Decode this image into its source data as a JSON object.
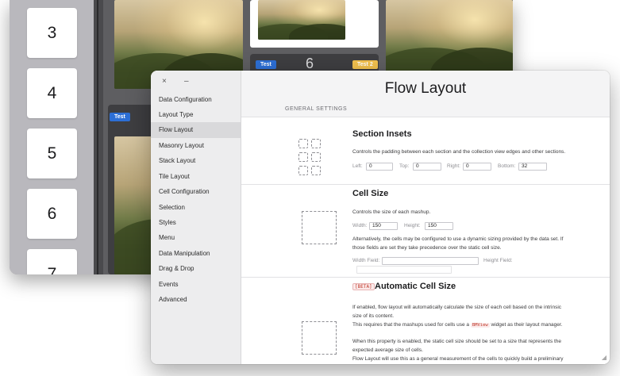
{
  "back_window": {
    "sidebar_tiles": [
      "3",
      "4",
      "5",
      "6",
      "7"
    ],
    "badges": {
      "test_left": "Test",
      "test_mid": "Test",
      "test_right": "Test 2",
      "counter": "6"
    }
  },
  "front_window": {
    "controls": {
      "close": "×",
      "minimize": "–"
    },
    "sidebar": {
      "items": [
        {
          "label": "Data Configuration"
        },
        {
          "label": "Layout Type"
        },
        {
          "label": "Flow Layout"
        },
        {
          "label": "Masonry Layout"
        },
        {
          "label": "Stack Layout"
        },
        {
          "label": "Tile Layout"
        },
        {
          "label": "Cell Configuration"
        },
        {
          "label": "Selection"
        },
        {
          "label": "Styles"
        },
        {
          "label": "Menu"
        },
        {
          "label": "Data Manipulation"
        },
        {
          "label": "Drag & Drop"
        },
        {
          "label": "Events"
        },
        {
          "label": "Advanced"
        }
      ],
      "active_index": 2
    },
    "main": {
      "title": "Flow Layout",
      "section_caption": "GENERAL SETTINGS",
      "section_insets": {
        "title": "Section Insets",
        "description": "Controls the padding between each section and the collection view edges and other sections.",
        "left_label": "Left:",
        "left_value": "0",
        "top_label": "Top:",
        "top_value": "0",
        "right_label": "Right:",
        "right_value": "0",
        "bottom_label": "Bottom:",
        "bottom_value": "32"
      },
      "cell_size": {
        "title": "Cell Size",
        "description": "Controls the size of each mashup.",
        "width_label": "Width:",
        "width_value": "150",
        "height_label": "Height:",
        "height_value": "150",
        "alt_line1": "Alternatively, the cells may be configured to use a dynamic sizing provided by the data set. If",
        "alt_line2": "those fields are set they take precedence over the static cell size.",
        "width_field_label": "Width Field:",
        "height_field_label": "Height Field:"
      },
      "auto_cell_size": {
        "beta": "[BETA]",
        "title": "Automatic Cell Size",
        "line1": "If enabled, flow layout will automatically calculate the size of each cell based on the intrinsic",
        "line2": "size of its content.",
        "line3_pre": "This requires that the mashups used for cells use a",
        "line3_code": "BMView",
        "line3_post": "widget as their layout manager.",
        "line4": "When this property is enabled, the static cell size should be set to a size that represents the",
        "line5": "expected average size of cells.",
        "line6": "Flow Layout will use this as a general measurement of the cells to quickly build a preliminary"
      }
    }
  }
}
